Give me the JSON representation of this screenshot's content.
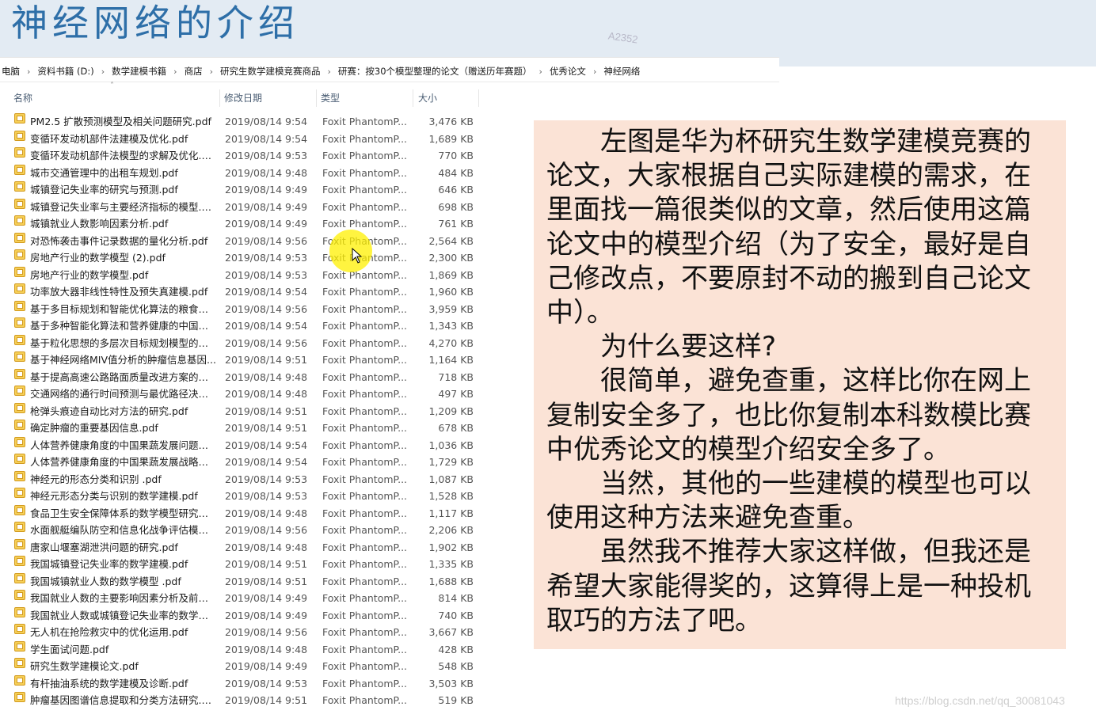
{
  "slide": {
    "title": "神经网络的介绍",
    "tag": "A2352",
    "footer_url": "https://blog.csdn.net/qq_30081043"
  },
  "breadcrumb": [
    "电脑",
    "资料书籍 (D:)",
    "数学建模书籍",
    "商店",
    "研究生数学建模竞赛商品",
    "研赛：按30个模型整理的论文（赠送历年赛题）",
    "优秀论文",
    "神经网络"
  ],
  "columns": {
    "name": "名称",
    "date": "修改日期",
    "type": "类型",
    "size": "大小"
  },
  "files": [
    {
      "name": "PM2.5 扩散预测模型及相关问题研究.pdf",
      "date": "2019/08/14 9:54",
      "type": "Foxit PhantomP...",
      "size": "3,476 KB"
    },
    {
      "name": "变循环发动机部件法建模及优化.pdf",
      "date": "2019/08/14 9:54",
      "type": "Foxit PhantomP...",
      "size": "1,689 KB"
    },
    {
      "name": "变循环发动机部件法模型的求解及优化.p...",
      "date": "2019/08/14 9:53",
      "type": "Foxit PhantomP...",
      "size": "770 KB"
    },
    {
      "name": "城市交通管理中的出租车规划.pdf",
      "date": "2019/08/14 9:48",
      "type": "Foxit PhantomP...",
      "size": "484 KB"
    },
    {
      "name": "城镇登记失业率的研究与预测.pdf",
      "date": "2019/08/14 9:49",
      "type": "Foxit PhantomP...",
      "size": "646 KB"
    },
    {
      "name": "城镇登记失业率与主要经济指标的模型.p...",
      "date": "2019/08/14 9:49",
      "type": "Foxit PhantomP...",
      "size": "698 KB"
    },
    {
      "name": "城镇就业人数影响因素分析.pdf",
      "date": "2019/08/14 9:49",
      "type": "Foxit PhantomP...",
      "size": "761 KB"
    },
    {
      "name": "对恐怖袭击事件记录数据的量化分析.pdf",
      "date": "2019/08/14 9:56",
      "type": "Foxit PhantomP...",
      "size": "2,564 KB"
    },
    {
      "name": "房地产行业的数学模型 (2).pdf",
      "date": "2019/08/14 9:53",
      "type": "Foxit PhantomP...",
      "size": "2,300 KB"
    },
    {
      "name": "房地产行业的数学模型.pdf",
      "date": "2019/08/14 9:53",
      "type": "Foxit PhantomP...",
      "size": "1,869 KB"
    },
    {
      "name": "功率放大器非线性特性及预失真建模.pdf",
      "date": "2019/08/14 9:54",
      "type": "Foxit PhantomP...",
      "size": "1,960 KB"
    },
    {
      "name": "基于多目标规划和智能优化算法的粮食最...",
      "date": "2019/08/14 9:56",
      "type": "Foxit PhantomP...",
      "size": "3,959 KB"
    },
    {
      "name": "基于多种智能化算法和营养健康的中国果...",
      "date": "2019/08/14 9:54",
      "type": "Foxit PhantomP...",
      "size": "1,343 KB"
    },
    {
      "name": "基于粒化思想的多层次目标规划模型的研...",
      "date": "2019/08/14 9:56",
      "type": "Foxit PhantomP...",
      "size": "4,270 KB"
    },
    {
      "name": "基于神经网络MIV值分析的肿瘤信息基因...",
      "date": "2019/08/14 9:51",
      "type": "Foxit PhantomP...",
      "size": "1,164 KB"
    },
    {
      "name": "基于提高高速公路路面质量改进方案的探...",
      "date": "2019/08/14 9:48",
      "type": "Foxit PhantomP...",
      "size": "718 KB"
    },
    {
      "name": "交通网络的通行时间预测与最优路径决策...",
      "date": "2019/08/14 9:48",
      "type": "Foxit PhantomP...",
      "size": "497 KB"
    },
    {
      "name": "枪弹头痕迹自动比对方法的研究.pdf",
      "date": "2019/08/14 9:51",
      "type": "Foxit PhantomP...",
      "size": "1,209 KB"
    },
    {
      "name": "确定肿瘤的重要基因信息.pdf",
      "date": "2019/08/14 9:51",
      "type": "Foxit PhantomP...",
      "size": "678 KB"
    },
    {
      "name": "人体营养健康角度的中国果蔬发展问题研...",
      "date": "2019/08/14 9:54",
      "type": "Foxit PhantomP...",
      "size": "1,036 KB"
    },
    {
      "name": "人体营养健康角度的中国果蔬发展战略研...",
      "date": "2019/08/14 9:54",
      "type": "Foxit PhantomP...",
      "size": "1,729 KB"
    },
    {
      "name": "神经元的形态分类和识别 .pdf",
      "date": "2019/08/14 9:53",
      "type": "Foxit PhantomP...",
      "size": "1,087 KB"
    },
    {
      "name": "神经元形态分类与识别的数学建模.pdf",
      "date": "2019/08/14 9:53",
      "type": "Foxit PhantomP...",
      "size": "1,528 KB"
    },
    {
      "name": "食品卫生安全保障体系的数学模型研究（...",
      "date": "2019/08/14 9:48",
      "type": "Foxit PhantomP...",
      "size": "1,117 KB"
    },
    {
      "name": "水面舰艇编队防空和信息化战争评估模型...",
      "date": "2019/08/14 9:56",
      "type": "Foxit PhantomP...",
      "size": "2,206 KB"
    },
    {
      "name": "唐家山堰塞湖泄洪问题的研究.pdf",
      "date": "2019/08/14 9:48",
      "type": "Foxit PhantomP...",
      "size": "1,902 KB"
    },
    {
      "name": "我国城镇登记失业率的数学建模.pdf",
      "date": "2019/08/14 9:51",
      "type": "Foxit PhantomP...",
      "size": "1,335 KB"
    },
    {
      "name": "我国城镇就业人数的数学模型 .pdf",
      "date": "2019/08/14 9:51",
      "type": "Foxit PhantomP...",
      "size": "1,688 KB"
    },
    {
      "name": "我国就业人数的主要影响因素分析及前景...",
      "date": "2019/08/14 9:49",
      "type": "Foxit PhantomP...",
      "size": "814 KB"
    },
    {
      "name": "我国就业人数或城镇登记失业率的数学建...",
      "date": "2019/08/14 9:49",
      "type": "Foxit PhantomP...",
      "size": "740 KB"
    },
    {
      "name": "无人机在抢险救灾中的优化运用.pdf",
      "date": "2019/08/14 9:56",
      "type": "Foxit PhantomP...",
      "size": "3,667 KB"
    },
    {
      "name": "学生面试问题.pdf",
      "date": "2019/08/14 9:48",
      "type": "Foxit PhantomP...",
      "size": "428 KB"
    },
    {
      "name": "研究生数学建模论文.pdf",
      "date": "2019/08/14 9:49",
      "type": "Foxit PhantomP...",
      "size": "548 KB"
    },
    {
      "name": "有杆抽油系统的数学建模及诊断.pdf",
      "date": "2019/08/14 9:53",
      "type": "Foxit PhantomP...",
      "size": "3,503 KB"
    },
    {
      "name": "肿瘤基因图谱信息提取和分类方法研究.p...",
      "date": "2019/08/14 9:51",
      "type": "Foxit PhantomP...",
      "size": "519 KB"
    }
  ],
  "note": {
    "paragraphs": [
      "左图是华为杯研究生数学建模竞赛的论文，大家根据自己实际建模的需求，在里面找一篇很类似的文章，然后使用这篇论文中的模型介绍（为了安全，最好是自己修改点，不要原封不动的搬到自己论文中）。",
      "为什么要这样?",
      "很简单，避免查重，这样比你在网上复制安全多了，也比你复制本科数模比赛中优秀论文的模型介绍安全多了。",
      "当然，其他的一些建模的模型也可以使用这种方法来避免查重。",
      "虽然我不推荐大家这样做，但我还是希望大家能得奖的，这算得上是一种投机取巧的方法了吧。"
    ]
  },
  "colors": {
    "title": "#2e6fa8",
    "band": "#e3ebf3",
    "note_bg": "#fbe3d6",
    "highlight": "#fff000",
    "pdf_icon": "#f6cf57"
  }
}
